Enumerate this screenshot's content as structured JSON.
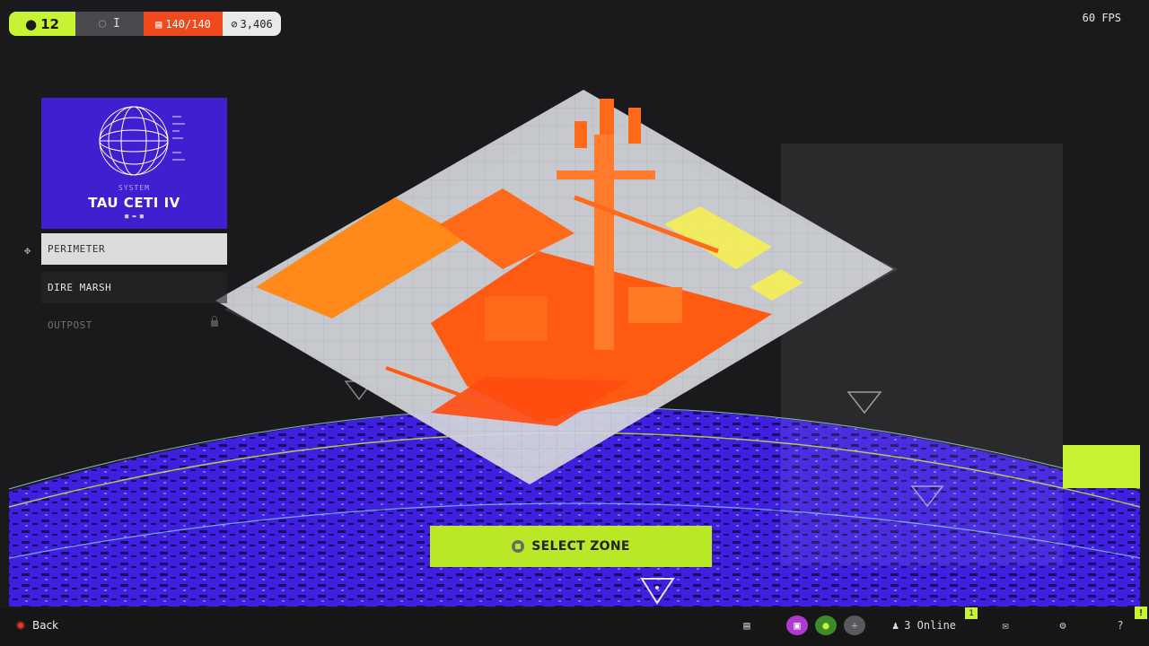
{
  "hud": {
    "level": "12",
    "rank": "I",
    "health": "140/140",
    "credits": "3,406",
    "fps": "60 FPS"
  },
  "system": {
    "label": "SYSTEM",
    "name": "TAU CETI IV"
  },
  "zones": [
    {
      "label": "PERIMETER",
      "state": "selected"
    },
    {
      "label": "DIRE MARSH",
      "state": "available"
    },
    {
      "label": "OUTPOST",
      "state": "locked"
    }
  ],
  "select_button": "SELECT ZONE",
  "footer": {
    "back": "Back",
    "online": "3 Online",
    "notification_count": "1",
    "alert": "!"
  },
  "colors": {
    "accent": "#c6f432",
    "planet": "#3a1ad8",
    "structure": "#ff6a1a",
    "health": "#f04a1c"
  }
}
